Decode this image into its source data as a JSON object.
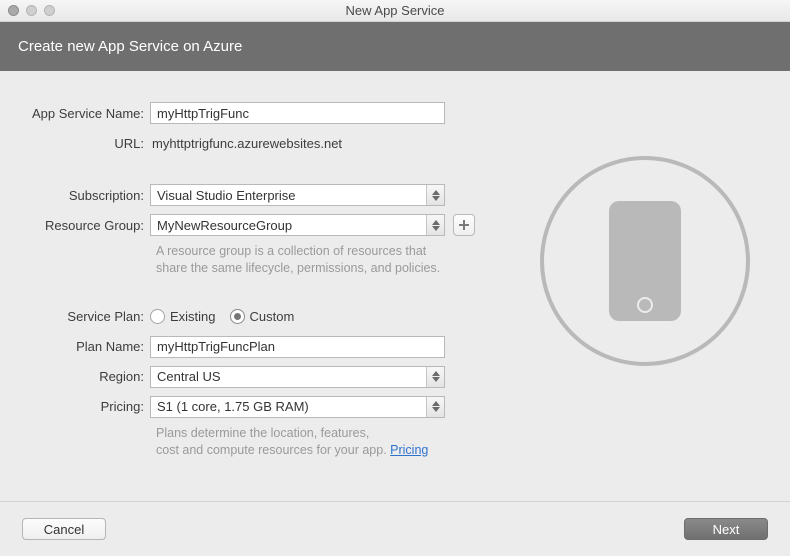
{
  "window": {
    "title": "New App Service"
  },
  "header": {
    "title": "Create new App Service on Azure"
  },
  "labels": {
    "app_service_name": "App Service Name:",
    "url": "URL:",
    "subscription": "Subscription:",
    "resource_group": "Resource Group:",
    "service_plan": "Service Plan:",
    "plan_name": "Plan Name:",
    "region": "Region:",
    "pricing": "Pricing:"
  },
  "fields": {
    "app_service_name": "myHttpTrigFunc",
    "url": "myhttptrigfunc.azurewebsites.net",
    "subscription": "Visual Studio Enterprise",
    "resource_group": "MyNewResourceGroup",
    "plan_name": "myHttpTrigFuncPlan",
    "region": "Central US",
    "pricing": "S1 (1 core, 1.75 GB RAM)"
  },
  "service_plan": {
    "existing": "Existing",
    "custom": "Custom",
    "selected": "custom"
  },
  "helpers": {
    "resource_group_l1": "A resource group is a collection of resources that",
    "resource_group_l2": "share the same lifecycle, permissions, and policies.",
    "pricing_l1": "Plans determine the location, features,",
    "pricing_l2_a": "cost and compute resources for your app. ",
    "pricing_link": "Pricing"
  },
  "buttons": {
    "cancel": "Cancel",
    "next": "Next"
  }
}
